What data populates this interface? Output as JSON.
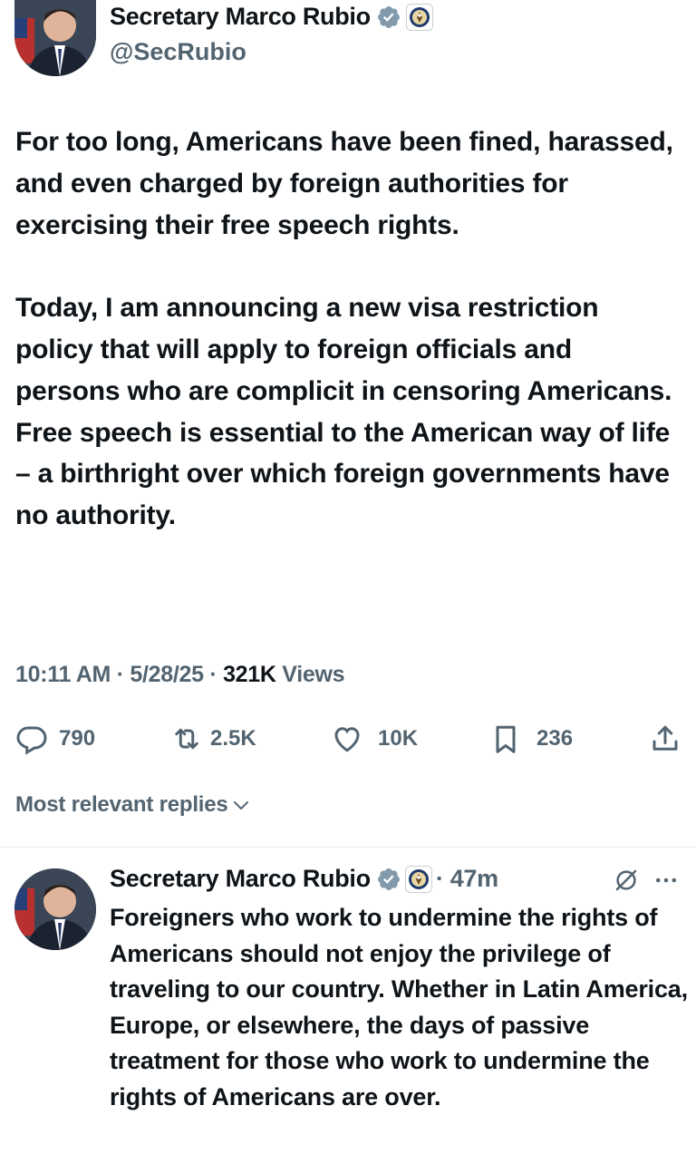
{
  "main_tweet": {
    "author_name": "Secretary Marco Rubio",
    "author_handle": "@SecRubio",
    "paragraph_1": "For too long, Americans have been fined, harassed, and even charged by foreign authorities for exercising their free speech rights.",
    "paragraph_2": "Today, I am announcing a new visa restriction policy that will apply to foreign officials and persons who are complicit in censoring Americans. Free speech is essential to the American way of life – a birthright over which foreign governments have no authority.",
    "time": "10:11 AM",
    "date": "5/28/25",
    "views_count": "321K",
    "views_label": "Views",
    "separator": "·"
  },
  "actions": {
    "replies": "790",
    "reposts": "2.5K",
    "likes": "10K",
    "bookmarks": "236"
  },
  "replies_filter": {
    "label": "Most relevant replies"
  },
  "reply": {
    "author_name": "Secretary Marco Rubio",
    "time": "· 47m",
    "text": "Foreigners who work to undermine the rights of Americans should not enjoy the privilege of traveling to our country. Whether in Latin America, Europe, or elsewhere, the days of passive treatment for those who work to undermine the rights of Americans are over."
  },
  "icons": {
    "verified": "verified-badge-icon",
    "government": "state-department-seal-icon",
    "reply": "reply-icon",
    "repost": "repost-icon",
    "like": "heart-icon",
    "bookmark": "bookmark-icon",
    "share": "share-icon",
    "grok": "grok-icon",
    "more": "more-icon",
    "chevron": "chevron-down-icon"
  },
  "colors": {
    "text": "#0f1419",
    "secondary": "#536471",
    "verified": "#829aab"
  }
}
